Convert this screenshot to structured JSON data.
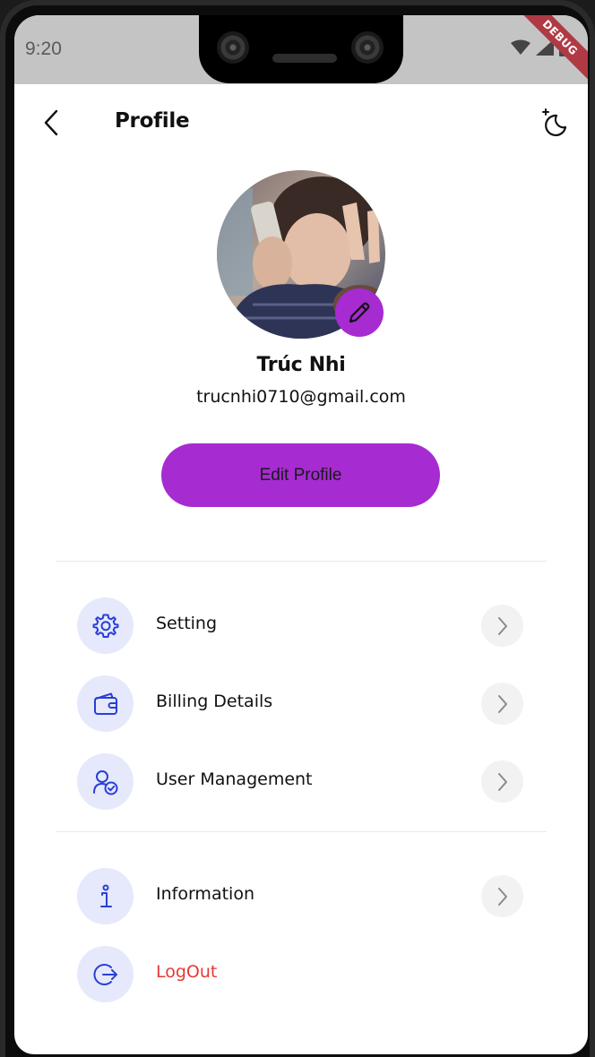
{
  "status_bar": {
    "time": "9:20",
    "debug_label": "DEBUG"
  },
  "header": {
    "title": "Profile",
    "back_icon": "chevron-left-icon",
    "theme_icon": "moon-stars-icon"
  },
  "profile": {
    "name": "Trúc Nhi",
    "email": "trucnhi0710@gmail.com",
    "edit_button_label": "Edit Profile",
    "accent_color": "#a62bd1"
  },
  "menu": {
    "primary": [
      {
        "label": "Setting",
        "icon": "gear-icon"
      },
      {
        "label": "Billing Details",
        "icon": "wallet-icon"
      },
      {
        "label": "User Management",
        "icon": "user-check-icon"
      }
    ],
    "secondary": [
      {
        "label": "Information",
        "icon": "info-icon"
      },
      {
        "label": "LogOut",
        "icon": "logout-icon",
        "danger": true
      }
    ]
  },
  "colors": {
    "icon_blue": "#2a3fd6",
    "icon_bg": "#e6e9fb",
    "danger": "#e53935"
  }
}
